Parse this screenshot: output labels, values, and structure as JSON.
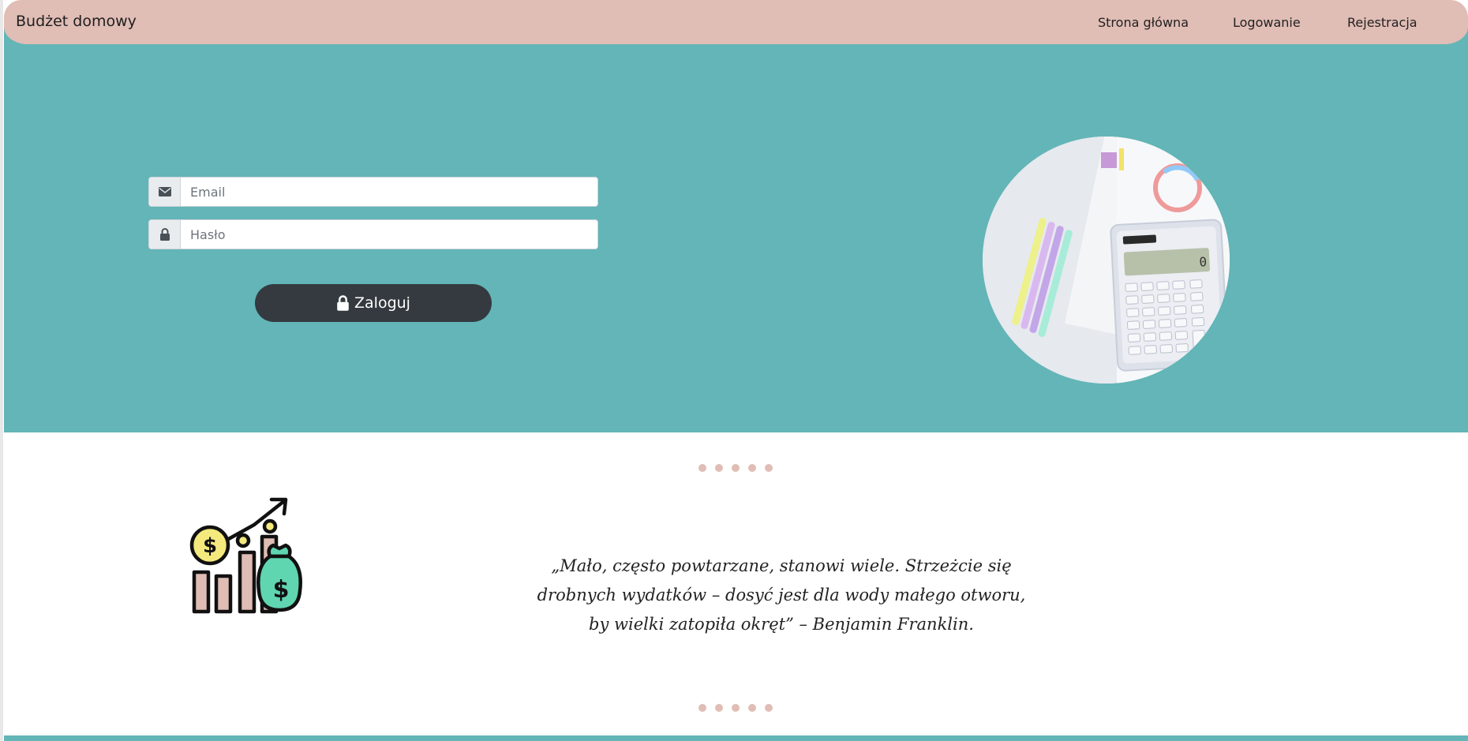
{
  "navbar": {
    "brand": "Budżet domowy",
    "links": [
      "Strona główna",
      "Logowanie",
      "Rejestracja"
    ]
  },
  "login": {
    "email_placeholder": "Email",
    "password_placeholder": "Hasło",
    "submit_label": "Zaloguj"
  },
  "quote": {
    "text": "„Mało, często powtarzane, stanowi wiele. Strzeżcie się drobnych wydatków – dosyć jest dla wody małego otworu, by wielki zatopiła okręt” – Benjamin Franklin."
  },
  "colors": {
    "navbar": "#e0bdb5",
    "hero": "#63b5b7",
    "button": "#343a40",
    "dots": "#e0bdb5"
  },
  "icons": [
    "envelope-icon",
    "lock-icon",
    "growth-chart-icon",
    "calculator-photo"
  ]
}
